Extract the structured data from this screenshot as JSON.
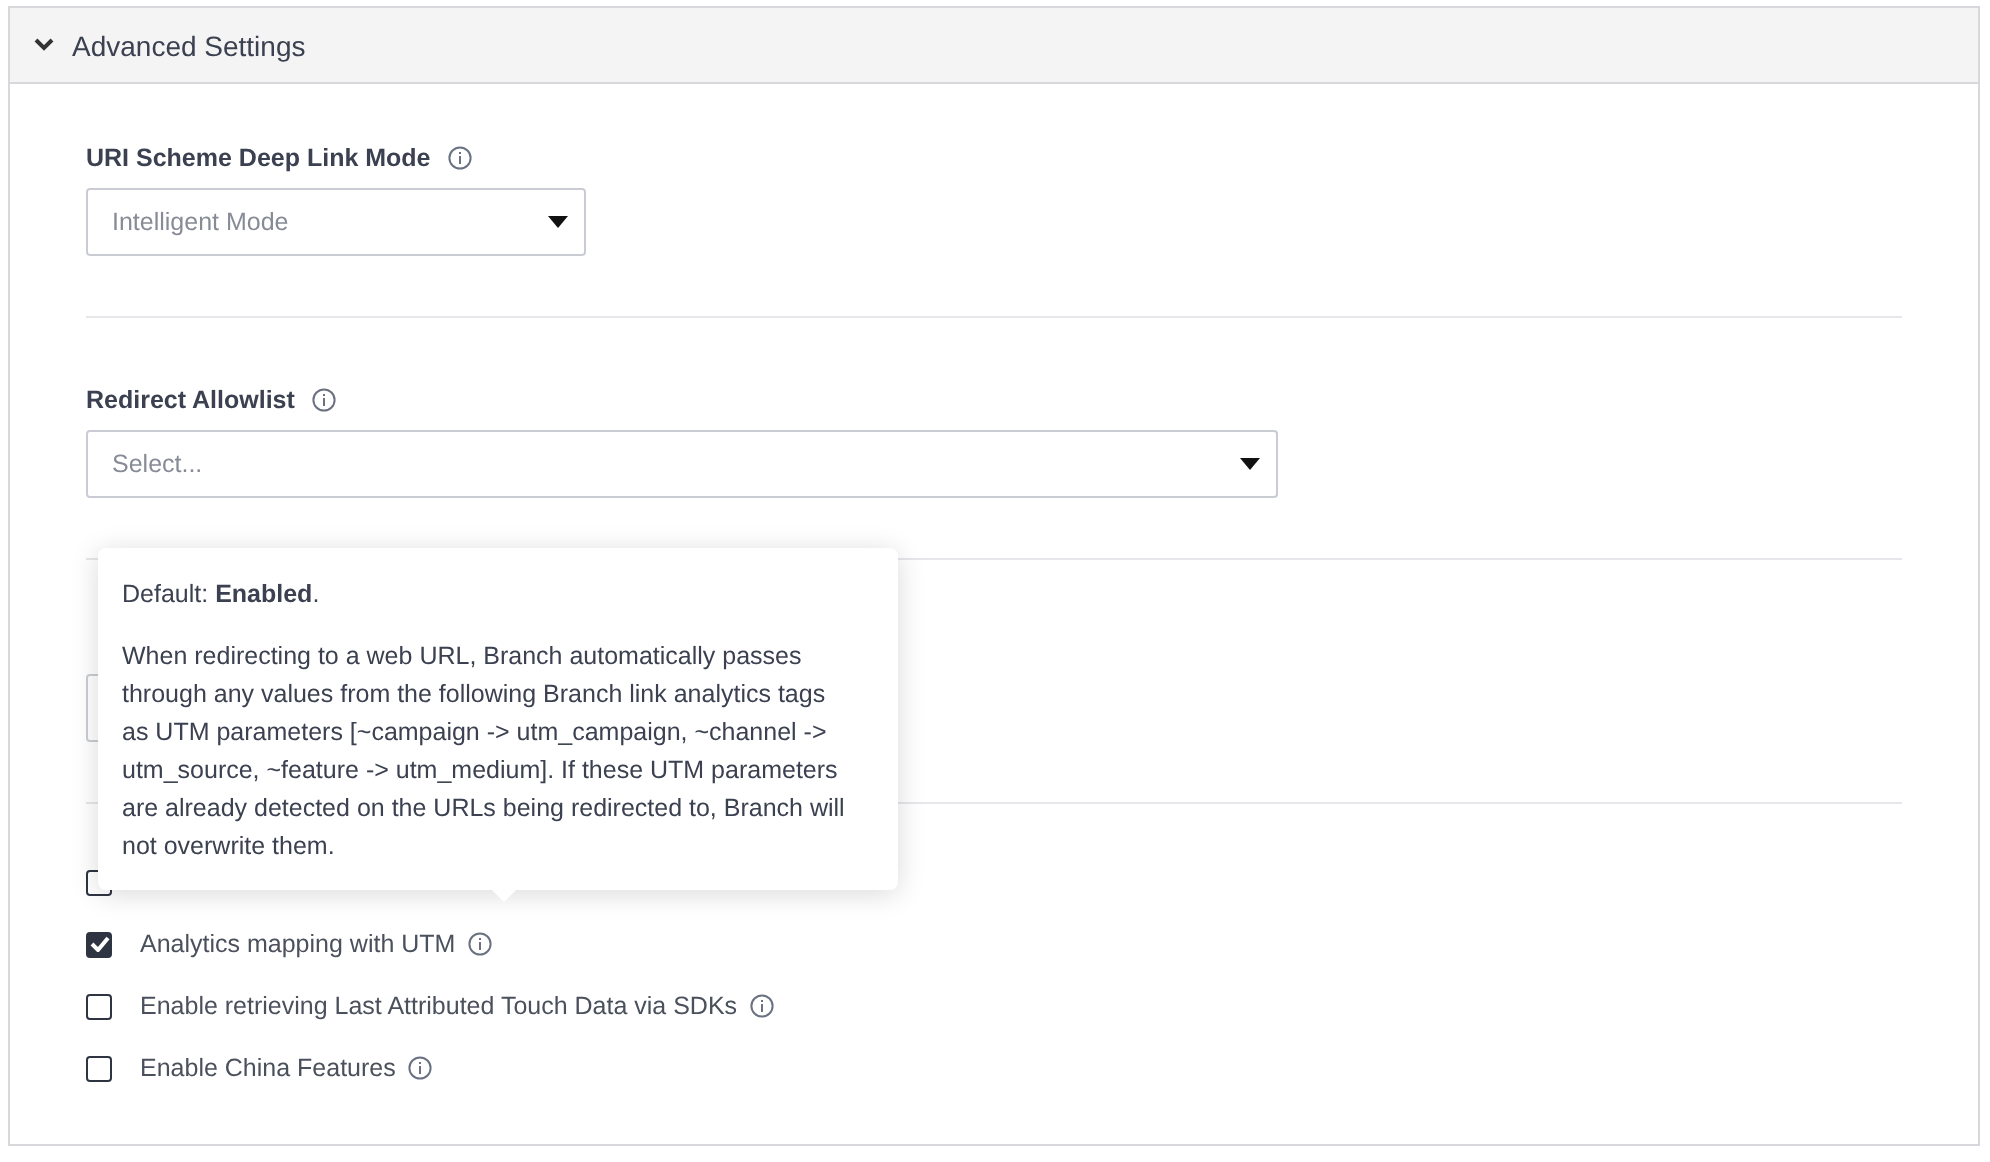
{
  "section": {
    "title": "Advanced Settings",
    "expanded": true
  },
  "fields": [
    {
      "label": "URI Scheme Deep Link Mode",
      "value": "Intelligent Mode"
    },
    {
      "label": "Redirect Allowlist",
      "placeholder": "Select..."
    }
  ],
  "checkboxes": [
    {
      "checked": false
    },
    {
      "label": "Analytics mapping with UTM",
      "checked": true
    },
    {
      "label": "Enable retrieving Last Attributed Touch Data via SDKs",
      "checked": false
    },
    {
      "label": "Enable China Features",
      "checked": false
    }
  ],
  "tooltip": {
    "lines": [
      "Default: **Enabled**.",
      "When redirecting to a web URL, Branch automatically passes through any values from the following Branch link analytics tags as UTM parameters [~campaign -> utm_campaign, ~channel -> utm_source, ~feature -> utm_medium]. If these UTM parameters are already detected on the URLs being redirected to, Branch will not overwrite them."
    ]
  }
}
